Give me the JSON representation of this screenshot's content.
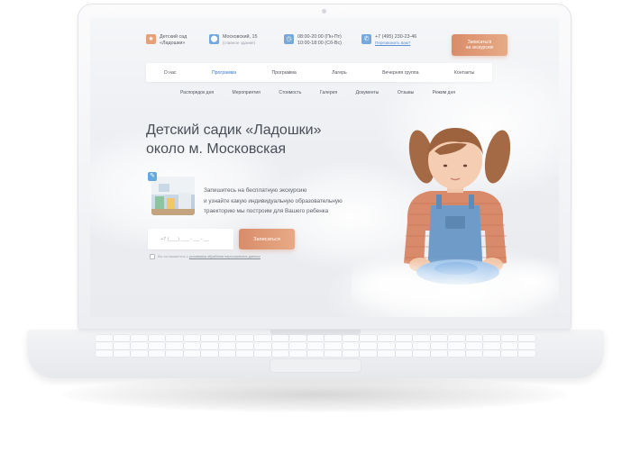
{
  "header": {
    "logo": {
      "line1": "Детский сад",
      "line2": "«Ладошки»",
      "icon": "star-icon"
    },
    "address": {
      "line1": "Московский, 15",
      "line2": "(главное здание)",
      "icon": "map-pin-icon"
    },
    "hours": {
      "line1": "08:00-20:00 (Пн-Пт)",
      "line2": "10:00-18:00 (Сб-Вс)",
      "icon": "clock-icon"
    },
    "contact": {
      "line1": "+7 (495) 230-23-46",
      "line2": "Перезвонить вам?",
      "icon": "phone-icon"
    },
    "cta_line1": "Записаться",
    "cta_line2": "на экскурсию"
  },
  "nav": {
    "items": [
      "О нас",
      "Программа",
      "Программа",
      "Лагерь",
      "Вечерняя группа",
      "Контакты"
    ],
    "active_index": 1
  },
  "subnav": {
    "items": [
      "Распорядок дня",
      "Мероприятия",
      "Стоимость",
      "Галерея",
      "Документы",
      "Отзывы",
      "Режим дня"
    ]
  },
  "hero": {
    "title_line1": "Детский садик «Ладошки»",
    "title_line2": "около м. Московская",
    "lead_line1": "Запишитесь на бесплатную экскурсию",
    "lead_line2": "и узнайте какую индивидуальную образовательную",
    "lead_line3": "траекторию мы построим для Вашего ребенка",
    "phone_placeholder": "+7 (___) ___ - __ - __",
    "submit_label": "Записаться",
    "consent_prefix": "Вы соглашаетесь с",
    "consent_link": "условиями обработки персональных данных"
  },
  "colors": {
    "accent": "#e19a76",
    "link": "#3b7cd6",
    "text": "#4a4f57"
  }
}
